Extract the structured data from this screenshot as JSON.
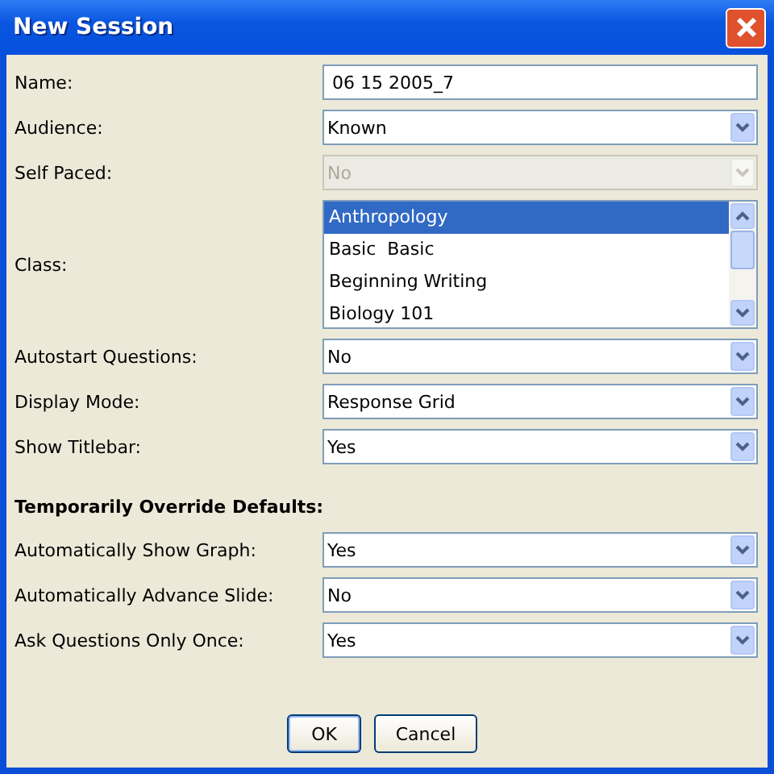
{
  "window": {
    "title": "New Session"
  },
  "fields": [
    {
      "kind": "text",
      "label": "Name:",
      "value": "06 15 2005_7"
    },
    {
      "kind": "select",
      "label": "Audience:",
      "value": "Known",
      "disabled": false
    },
    {
      "kind": "select",
      "label": "Self Paced:",
      "value": "No",
      "disabled": true
    },
    {
      "kind": "list",
      "label": "Class:",
      "items": [
        {
          "label": "Anthropology",
          "selected": true
        },
        {
          "label": "Basic  Basic",
          "selected": false
        },
        {
          "label": "Beginning Writing",
          "selected": false
        },
        {
          "label": "Biology 101",
          "selected": false
        }
      ]
    },
    {
      "kind": "select",
      "label": "Autostart Questions:",
      "value": "No",
      "disabled": false
    },
    {
      "kind": "select",
      "label": "Display Mode:",
      "value": "Response Grid",
      "disabled": false
    },
    {
      "kind": "select",
      "label": "Show Titlebar:",
      "value": "Yes",
      "disabled": false
    }
  ],
  "override": {
    "heading": "Temporarily Override Defaults:",
    "fields": [
      {
        "label": "Automatically Show Graph:",
        "value": "Yes",
        "disabled": false
      },
      {
        "label": "Automatically Advance Slide:",
        "value": "No",
        "disabled": false
      },
      {
        "label": "Ask Questions Only Once:",
        "value": "Yes",
        "disabled": false
      }
    ]
  },
  "buttons": [
    "OK",
    "Cancel"
  ]
}
